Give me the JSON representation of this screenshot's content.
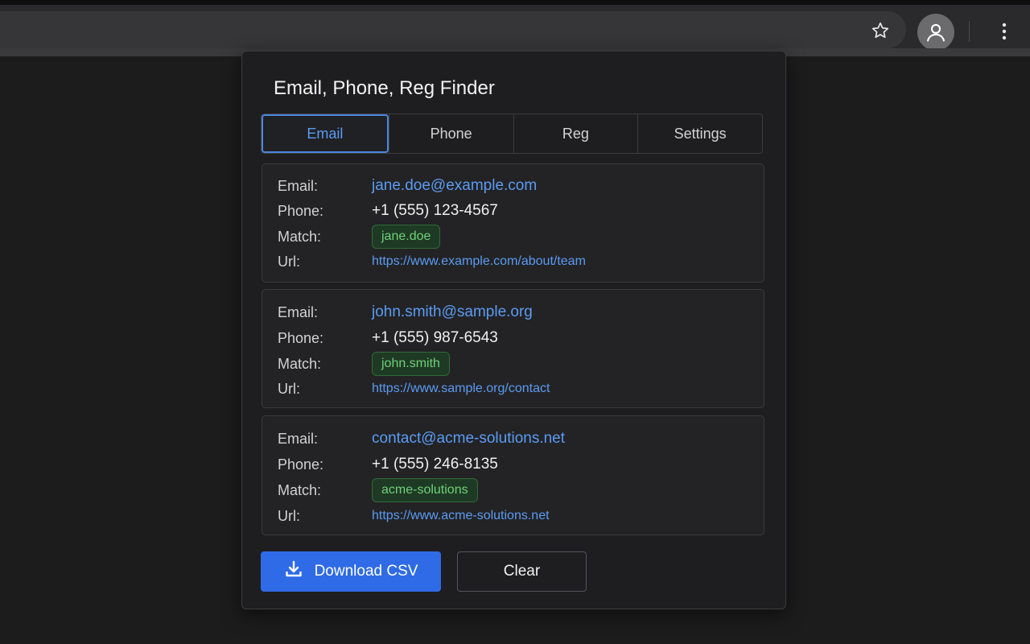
{
  "popup": {
    "title": "Email, Phone, Reg Finder",
    "tabs": [
      {
        "label": "Email",
        "active": true
      },
      {
        "label": "Phone",
        "active": false
      },
      {
        "label": "Reg",
        "active": false
      },
      {
        "label": "Settings",
        "active": false
      }
    ],
    "labels": {
      "email": "Email:",
      "phone": "Phone:",
      "match": "Match:",
      "url": "Url:"
    },
    "results": [
      {
        "email": "jane.doe@example.com",
        "phone": "+1 (555) 123-4567",
        "match": "jane.doe",
        "url": "https://www.example.com/about/team"
      },
      {
        "email": "john.smith@sample.org",
        "phone": "+1 (555) 987-6543",
        "match": "john.smith",
        "url": "https://www.sample.org/contact"
      },
      {
        "email": "contact@acme-solutions.net",
        "phone": "+1 (555) 246-8135",
        "match": "acme-solutions",
        "url": "https://www.acme-solutions.net"
      }
    ],
    "buttons": {
      "download": "Download CSV",
      "clear": "Clear"
    }
  },
  "colors": {
    "accent": "#2f6be6",
    "link": "#5b9bf2",
    "match_green": "#6dd07a"
  },
  "icons": [
    "star-icon",
    "profile-icon",
    "more-vert-icon",
    "download-icon"
  ]
}
